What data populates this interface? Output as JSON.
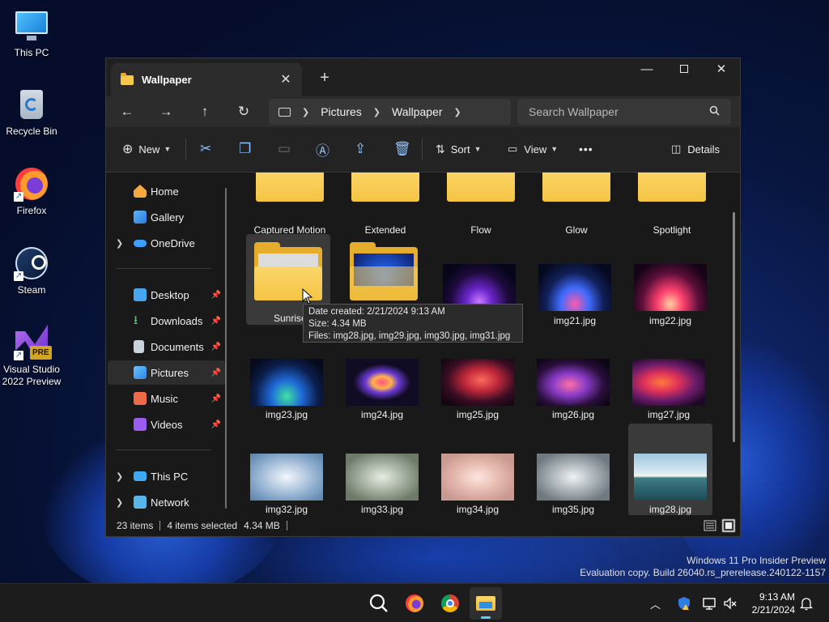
{
  "desktop": {
    "icons": [
      {
        "label": "This PC",
        "icon": "this-pc-icon"
      },
      {
        "label": "Recycle Bin",
        "icon": "recycle-bin-icon"
      },
      {
        "label": "Firefox",
        "icon": "firefox-icon"
      },
      {
        "label": "Steam",
        "icon": "steam-icon"
      },
      {
        "label": "Visual Studio 2022 Preview",
        "icon": "visual-studio-icon",
        "badge": "PRE"
      }
    ]
  },
  "window": {
    "tab_title": "Wallpaper",
    "new_tab_glyph": "+",
    "close_glyph": "✕",
    "minimize_glyph": "—",
    "breadcrumb": [
      "Pictures",
      "Wallpaper"
    ],
    "search_placeholder": "Search Wallpaper",
    "toolbar": {
      "new_label": "New",
      "sort_label": "Sort",
      "view_label": "View",
      "more_label": "•••",
      "details_label": "Details"
    },
    "sidebar": {
      "top": [
        {
          "label": "Home",
          "icon": "home-icon"
        },
        {
          "label": "Gallery",
          "icon": "gallery-icon"
        },
        {
          "label": "OneDrive",
          "icon": "onedrive-icon"
        }
      ],
      "pinned": [
        {
          "label": "Desktop",
          "icon": "desktop-folder-icon"
        },
        {
          "label": "Downloads",
          "icon": "downloads-icon"
        },
        {
          "label": "Documents",
          "icon": "documents-icon"
        },
        {
          "label": "Pictures",
          "icon": "pictures-icon"
        },
        {
          "label": "Music",
          "icon": "music-icon"
        },
        {
          "label": "Videos",
          "icon": "videos-icon"
        }
      ],
      "bottom": [
        {
          "label": "This PC",
          "icon": "this-pc-icon"
        },
        {
          "label": "Network",
          "icon": "network-icon"
        }
      ]
    },
    "files": {
      "row1": [
        "Captured Motion",
        "Extended",
        "Flow",
        "Glow",
        "Spotlight"
      ],
      "row2": [
        "Sunrise",
        "",
        "",
        "img21.jpg",
        "img22.jpg"
      ],
      "row3": [
        "img23.jpg",
        "img24.jpg",
        "img25.jpg",
        "img26.jpg",
        "img27.jpg"
      ],
      "row4": [
        "img32.jpg",
        "img33.jpg",
        "img34.jpg",
        "img35.jpg",
        "img28.jpg"
      ]
    },
    "tooltip": {
      "line1": "Date created: 2/21/2024 9:13 AM",
      "line2": "Size: 4.34 MB",
      "line3": "Files: img28.jpg, img29.jpg, img30.jpg, img31.jpg"
    },
    "status": {
      "items": "23 items",
      "selected": "4 items selected",
      "size": "4.34 MB"
    }
  },
  "watermark": {
    "line1": "Windows 11 Pro Insider Preview",
    "line2": "Evaluation copy. Build 26040.rs_prerelease.240122-1157"
  },
  "taskbar": {
    "time": "9:13 AM",
    "date": "2/21/2024"
  },
  "colors": {
    "accent": "#60cdff",
    "folder": "#f4c443"
  }
}
